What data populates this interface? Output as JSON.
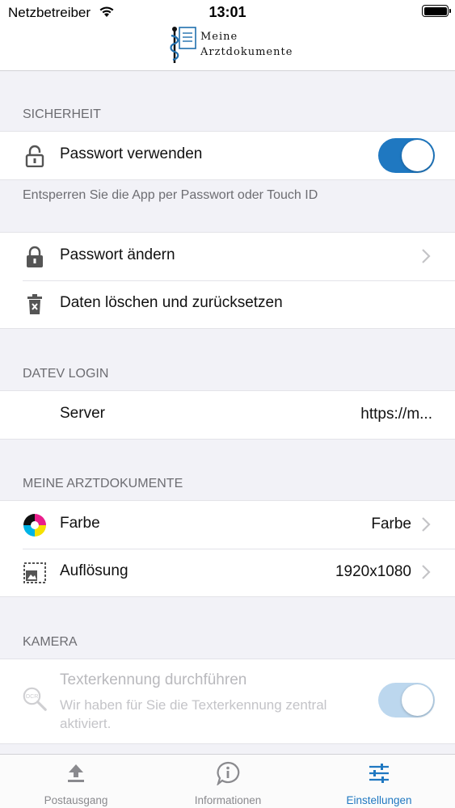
{
  "status_bar": {
    "carrier": "Netzbetreiber",
    "time": "13:01"
  },
  "header": {
    "logo_line1": "Meine",
    "logo_line2": "Arztdokumente"
  },
  "colors": {
    "accent": "#1f78c1",
    "secondary_text": "#6d6d72",
    "background": "#f2f2f7"
  },
  "sections": {
    "sicherheit": {
      "header": "SICHERHEIT",
      "use_password_label": "Passwort verwenden",
      "use_password_enabled": true,
      "footer": "Entsperren Sie die App per Passwort oder Touch ID"
    },
    "password": {
      "change_label": "Passwort ändern",
      "reset_label": "Daten löschen und zurücksetzen"
    },
    "datev": {
      "header": "DATEV LOGIN",
      "server_label": "Server",
      "server_value": "https://m..."
    },
    "meine": {
      "header": "MEINE ARZTDOKUMENTE",
      "color_label": "Farbe",
      "color_value": "Farbe",
      "resolution_label": "Auflösung",
      "resolution_value": "1920x1080"
    },
    "kamera": {
      "header": "KAMERA",
      "ocr_label": "Texterkennung durchführen",
      "ocr_sub": "Wir haben für Sie die Texterkennung zentral aktiviert.",
      "ocr_enabled": true,
      "ocr_icon_text": "OCR"
    }
  },
  "tabbar": {
    "tabs": [
      {
        "label": "Postausgang",
        "icon": "upload-icon",
        "active": false
      },
      {
        "label": "Informationen",
        "icon": "info-icon",
        "active": false
      },
      {
        "label": "Einstellungen",
        "icon": "sliders-icon",
        "active": true
      }
    ]
  }
}
